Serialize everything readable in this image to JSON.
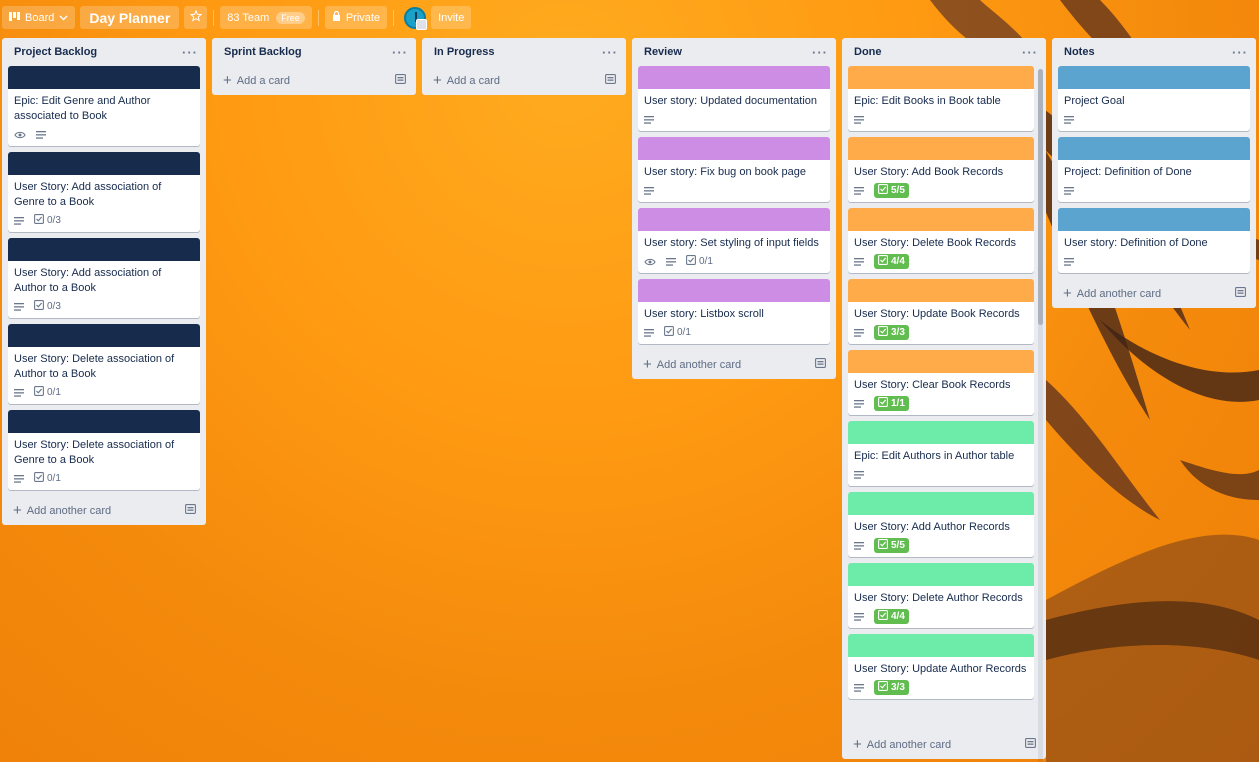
{
  "header": {
    "board_label": "Board",
    "title": "Day Planner",
    "team": "83 Team",
    "plan_badge": "Free",
    "visibility": "Private",
    "invite": "Invite"
  },
  "colors": {
    "navy": "#172b4d",
    "purple": "#cd8de5",
    "orange": "#ffab4a",
    "green": "#6deca9",
    "blue": "#5ba4cf",
    "check_green": "#61bd4f"
  },
  "lists": [
    {
      "title": "Project Backlog",
      "add_label": "Add another card",
      "cards": [
        {
          "title": "Epic: Edit Genre and Author associated to Book",
          "cover": "navy",
          "watch": true,
          "desc": true
        },
        {
          "title": "User Story: Add association of Genre to a Book",
          "cover": "navy",
          "desc": true,
          "check": "0/3"
        },
        {
          "title": "User Story: Add association of Author to a Book",
          "cover": "navy",
          "desc": true,
          "check": "0/3"
        },
        {
          "title": "User Story: Delete association of Author to a Book",
          "cover": "navy",
          "desc": true,
          "check": "0/1"
        },
        {
          "title": "User Story: Delete association of Genre to a Book",
          "cover": "navy",
          "desc": true,
          "check": "0/1"
        }
      ]
    },
    {
      "title": "Sprint Backlog",
      "add_label": "Add a card",
      "cards": []
    },
    {
      "title": "In Progress",
      "add_label": "Add a card",
      "cards": []
    },
    {
      "title": "Review",
      "add_label": "Add another card",
      "cards": [
        {
          "title": "User story: Updated documentation",
          "cover": "purple",
          "desc": true
        },
        {
          "title": "User story: Fix bug on book page",
          "cover": "purple",
          "desc": true
        },
        {
          "title": "User story: Set styling of input fields",
          "cover": "purple",
          "watch": true,
          "desc": true,
          "check": "0/1"
        },
        {
          "title": "User story: Listbox scroll",
          "cover": "purple",
          "desc": true,
          "check": "0/1"
        }
      ]
    },
    {
      "title": "Done",
      "add_label": "Add another card",
      "cards": [
        {
          "title": "Epic: Edit Books in Book table",
          "cover": "orange",
          "desc": true
        },
        {
          "title": "User Story: Add Book Records",
          "cover": "orange",
          "desc": true,
          "check_done": "5/5"
        },
        {
          "title": "User Story: Delete Book Records",
          "cover": "orange",
          "desc": true,
          "check_done": "4/4"
        },
        {
          "title": "User Story: Update Book Records",
          "cover": "orange",
          "desc": true,
          "check_done": "3/3"
        },
        {
          "title": "User Story: Clear Book Records",
          "cover": "orange",
          "desc": true,
          "check_done": "1/1"
        },
        {
          "title": "Epic: Edit Authors in Author table",
          "cover": "green",
          "desc": true
        },
        {
          "title": "User Story: Add Author Records",
          "cover": "green",
          "desc": true,
          "check_done": "5/5"
        },
        {
          "title": "User Story: Delete Author Records",
          "cover": "green",
          "desc": true,
          "check_done": "4/4"
        },
        {
          "title": "User Story: Update Author Records",
          "cover": "green",
          "desc": true,
          "check_done": "3/3"
        }
      ]
    },
    {
      "title": "Notes",
      "add_label": "Add another card",
      "cards": [
        {
          "title": "Project Goal",
          "cover": "blue",
          "desc": true
        },
        {
          "title": "Project: Definition of Done",
          "cover": "blue",
          "desc": true
        },
        {
          "title": "User story: Definition of Done",
          "cover": "blue",
          "desc": true
        }
      ]
    }
  ]
}
